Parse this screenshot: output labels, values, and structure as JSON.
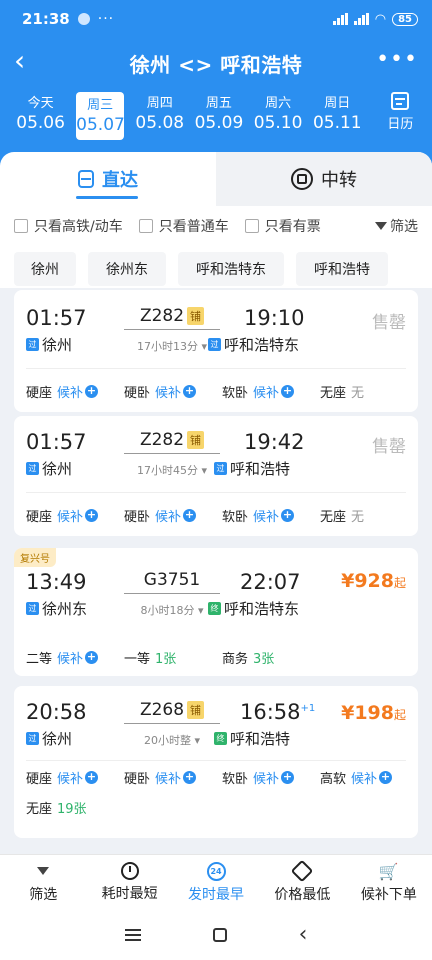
{
  "status": {
    "time": "21:38",
    "battery": "85",
    "dots": "···"
  },
  "nav": {
    "back": "‹",
    "title": "徐州 <> 呼和浩特",
    "more": "•••"
  },
  "dates": [
    {
      "day": "今天",
      "date": "05.06"
    },
    {
      "day": "周三",
      "date": "05.07"
    },
    {
      "day": "周四",
      "date": "05.08"
    },
    {
      "day": "周五",
      "date": "05.09"
    },
    {
      "day": "周六",
      "date": "05.10"
    },
    {
      "day": "周日",
      "date": "05.11"
    }
  ],
  "calendar_label": "日历",
  "tabs": {
    "direct": "直达",
    "transfer": "中转"
  },
  "filters": {
    "hsr": "只看高铁/动车",
    "normal": "只看普通车",
    "available": "只看有票",
    "filter": "筛选"
  },
  "stations": [
    "徐州",
    "徐州东",
    "呼和浩特东",
    "呼和浩特"
  ],
  "trains": [
    {
      "dep_time": "01:57",
      "train_no": "Z282",
      "bed_tag": "铺",
      "arr_time": "19:10",
      "duration": "17小时13分",
      "from_tag": "过",
      "from": "徐州",
      "to_tag": "过",
      "to": "呼和浩特东",
      "state": "售罄",
      "seats": [
        {
          "type": "硬座",
          "value": "候补"
        },
        {
          "type": "硬卧",
          "value": "候补"
        },
        {
          "type": "软卧",
          "value": "候补"
        },
        {
          "type": "无座",
          "value": "无"
        }
      ]
    },
    {
      "dep_time": "01:57",
      "train_no": "Z282",
      "bed_tag": "铺",
      "arr_time": "19:42",
      "duration": "17小时45分",
      "from_tag": "过",
      "from": "徐州",
      "to_tag": "过",
      "to": "呼和浩特",
      "state": "售罄",
      "seats": [
        {
          "type": "硬座",
          "value": "候补"
        },
        {
          "type": "硬卧",
          "value": "候补"
        },
        {
          "type": "软卧",
          "value": "候补"
        },
        {
          "type": "无座",
          "value": "无"
        }
      ]
    },
    {
      "badge": "复兴号",
      "dep_time": "13:49",
      "train_no": "G3751",
      "arr_time": "22:07",
      "duration": "8小时18分",
      "from_tag": "过",
      "from": "徐州东",
      "to_tag": "终",
      "to": "呼和浩特东",
      "price": "¥928",
      "price_suffix": "起",
      "seats": [
        {
          "type": "二等",
          "value": "候补"
        },
        {
          "type": "一等",
          "value": "1张"
        },
        {
          "type": "商务",
          "value": "3张"
        }
      ]
    },
    {
      "dep_time": "20:58",
      "train_no": "Z268",
      "bed_tag": "铺",
      "arr_time": "16:58",
      "day_offset": "+1",
      "duration": "20小时整",
      "from_tag": "过",
      "from": "徐州",
      "to_tag": "终",
      "to": "呼和浩特",
      "price": "¥198",
      "price_suffix": "起",
      "seats": [
        {
          "type": "硬座",
          "value": "候补"
        },
        {
          "type": "硬卧",
          "value": "候补"
        },
        {
          "type": "软卧",
          "value": "候补"
        },
        {
          "type": "高软",
          "value": "候补"
        },
        {
          "type": "无座",
          "value": "19张"
        }
      ]
    }
  ],
  "bottom_nav": [
    {
      "label": "筛选",
      "icon": "funnel-icon"
    },
    {
      "label": "耗时最短",
      "icon": "clock-icon"
    },
    {
      "label": "发时最早",
      "icon": "24h-icon",
      "icon_text": "24"
    },
    {
      "label": "价格最低",
      "icon": "price-tag-icon"
    },
    {
      "label": "候补下单",
      "icon": "cart-icon"
    }
  ],
  "colors": {
    "primary": "#2b8ff0",
    "price": "#f37a1f",
    "available": "#2fb36b",
    "soldout": "#bbbbbb"
  }
}
